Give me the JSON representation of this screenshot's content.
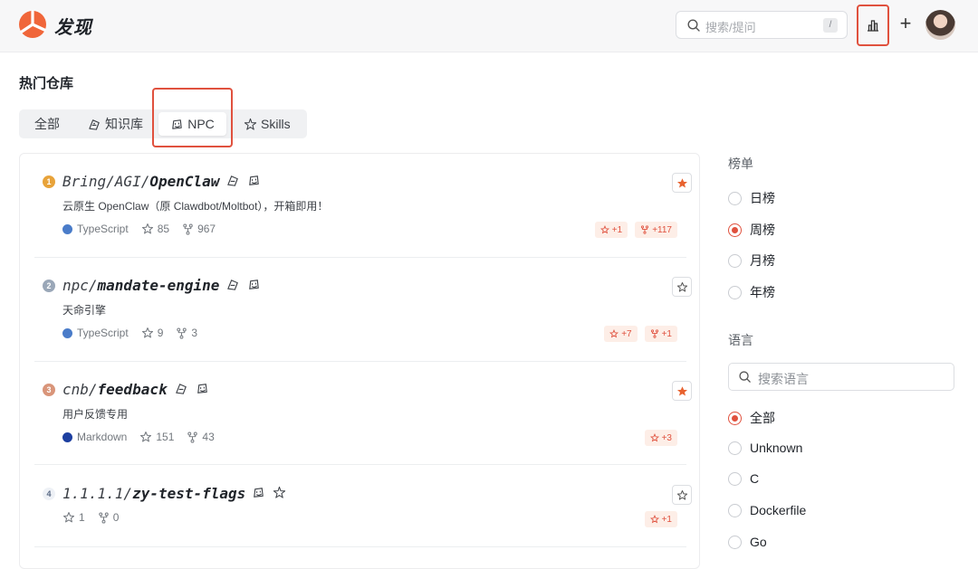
{
  "header": {
    "app_title": "发现",
    "search_placeholder": "搜索/提问",
    "search_shortcut": "/",
    "plus_label": "+"
  },
  "main": {
    "section_title": "热门仓库",
    "tabs": [
      {
        "label": "全部"
      },
      {
        "label": "知识库"
      },
      {
        "label": "NPC"
      },
      {
        "label": "Skills"
      }
    ]
  },
  "repos": [
    {
      "rank": "1",
      "owner": "Bring/AGI/",
      "name": "OpenClaw",
      "description": "云原生 OpenClaw（原 Clawdbot/Moltbot），开箱即用！",
      "language": "TypeScript",
      "language_color": "#4a7cc9",
      "stars": "85",
      "forks": "967",
      "starred": true,
      "chips": [
        {
          "kind": "star",
          "text": "+1"
        },
        {
          "kind": "fork",
          "text": "+117"
        }
      ]
    },
    {
      "rank": "2",
      "owner": "npc/",
      "name": "mandate-engine",
      "description": "天命引擎",
      "language": "TypeScript",
      "language_color": "#4a7cc9",
      "stars": "9",
      "forks": "3",
      "starred": false,
      "chips": [
        {
          "kind": "star",
          "text": "+7"
        },
        {
          "kind": "fork",
          "text": "+1"
        }
      ]
    },
    {
      "rank": "3",
      "owner": "cnb/",
      "name": "feedback",
      "description": "用户反馈专用",
      "language": "Markdown",
      "language_color": "#1d3fa0",
      "stars": "151",
      "forks": "43",
      "starred": true,
      "chips": [
        {
          "kind": "star",
          "text": "+3"
        }
      ]
    },
    {
      "rank": "4",
      "owner": "1.1.1.1/",
      "name": "zy-test-flags",
      "description": "",
      "language": "",
      "language_color": "",
      "stars": "1",
      "forks": "0",
      "starred": false,
      "chips": [
        {
          "kind": "star",
          "text": "+1"
        }
      ]
    }
  ],
  "sidebar": {
    "ranking_label": "榜单",
    "ranking_options": [
      {
        "label": "日榜",
        "selected": false
      },
      {
        "label": "周榜",
        "selected": true
      },
      {
        "label": "月榜",
        "selected": false
      },
      {
        "label": "年榜",
        "selected": false
      }
    ],
    "language_label": "语言",
    "language_search_placeholder": "搜索语言",
    "language_options": [
      {
        "label": "全部",
        "selected": true
      },
      {
        "label": "Unknown",
        "selected": false
      },
      {
        "label": "C",
        "selected": false
      },
      {
        "label": "Dockerfile",
        "selected": false
      },
      {
        "label": "Go",
        "selected": false
      }
    ]
  },
  "colors": {
    "accent": "#e0513e",
    "star_filled": "#e8622f",
    "gold": "#e8a33a",
    "silver": "#9aa7b8",
    "bronze": "#d9957a"
  }
}
